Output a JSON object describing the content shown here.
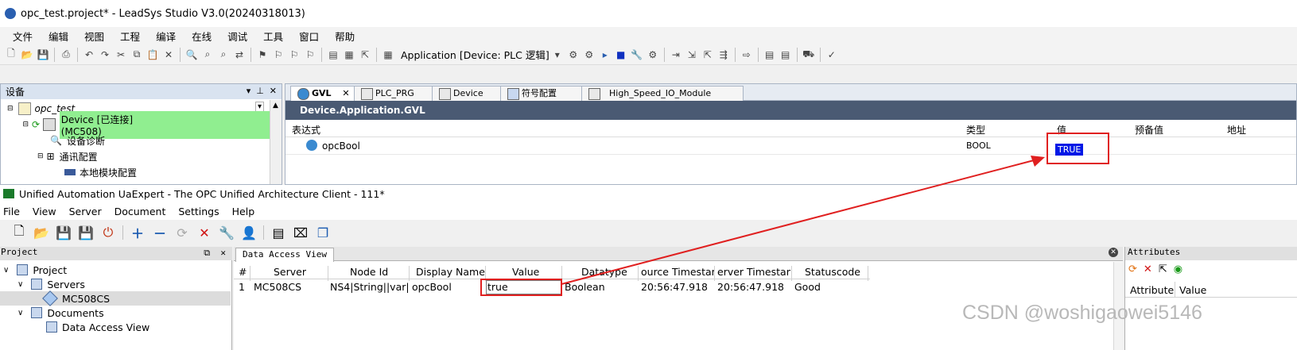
{
  "leadsys": {
    "title": "opc_test.project* - LeadSys Studio V3.0(20240318013)",
    "menu": [
      "文件",
      "编辑",
      "视图",
      "工程",
      "编译",
      "在线",
      "调试",
      "工具",
      "窗口",
      "帮助"
    ],
    "app_selector": "Application [Device: PLC 逻辑]",
    "device_panel": {
      "header": "设备",
      "tree": {
        "project": "opc_test",
        "device": "Device [已连接] (MC508)",
        "diag": "设备诊断",
        "comm": "通讯配置",
        "local_module": "本地模块配置"
      }
    },
    "editor": {
      "tabs": [
        "GVL",
        "PLC_PRG",
        "Device",
        "符号配置",
        "High_Speed_IO_Module"
      ],
      "path": "Device.Application.GVL",
      "columns": {
        "expr": "表达式",
        "type": "类型",
        "value": "值",
        "prepared": "预备值",
        "address": "地址"
      },
      "row": {
        "expr": "opcBool",
        "type": "BOOL",
        "value": "TRUE"
      }
    }
  },
  "uaexpert": {
    "title": "Unified Automation UaExpert - The OPC Unified Architecture Client - 111*",
    "menu": [
      "File",
      "View",
      "Server",
      "Document",
      "Settings",
      "Help"
    ],
    "project_panel": {
      "header": "Project",
      "items": {
        "project": "Project",
        "servers": "Servers",
        "server": "MC508CS",
        "documents": "Documents",
        "dav": "Data Access View"
      }
    },
    "data_access_view": {
      "tab": "Data Access View",
      "columns": [
        "#",
        "Server",
        "Node Id",
        "Display Name",
        "Value",
        "Datatype",
        "ource Timestam",
        "erver Timestam",
        "Statuscode"
      ],
      "row": [
        "1",
        "MC508CS",
        "NS4|String||var|...",
        "opcBool",
        "true",
        "Boolean",
        "20:56:47.918",
        "20:56:47.918",
        "Good"
      ]
    },
    "attributes_panel": {
      "header": "Attributes",
      "columns": [
        "Attribute",
        "Value"
      ]
    }
  },
  "watermark": "CSDN @woshigaowei5146",
  "colors": {
    "highlight_red": "#e02020",
    "true_bg": "#0018e6",
    "connected_green": "#90ee90",
    "path_bar": "#4a5a73"
  }
}
